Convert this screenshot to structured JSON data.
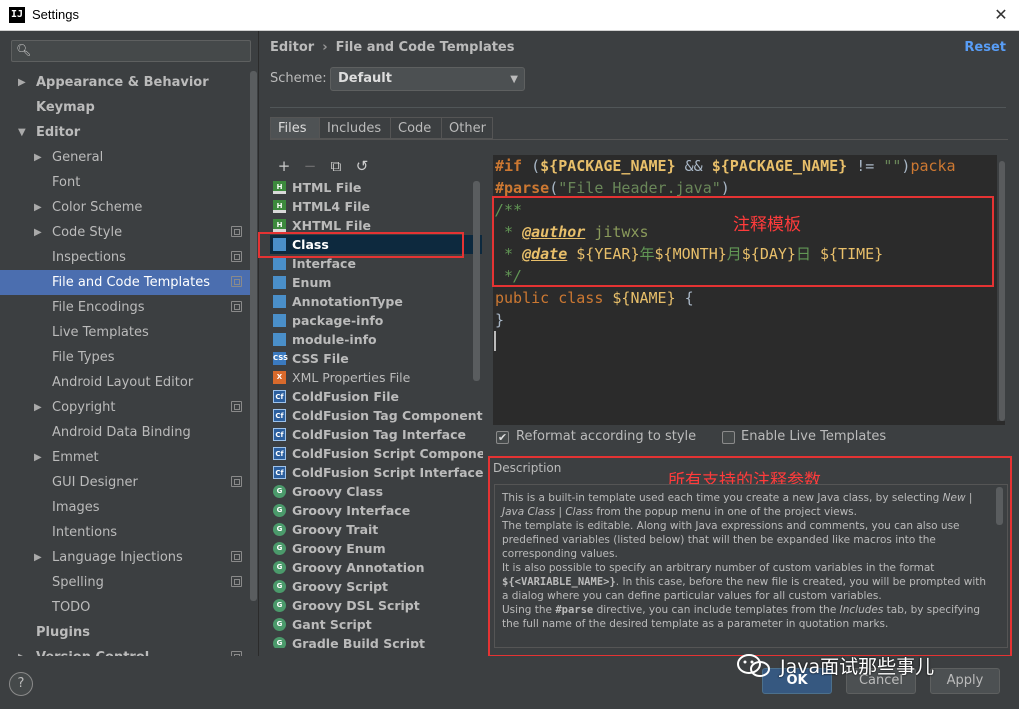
{
  "window": {
    "title": "Settings",
    "app_icon": "IJ"
  },
  "search": {
    "placeholder": ""
  },
  "sidebar": {
    "items": [
      {
        "label": "Appearance & Behavior",
        "level": 0,
        "arrow": "▶",
        "bold": true
      },
      {
        "label": "Keymap",
        "level": 0,
        "arrow": "",
        "bold": true
      },
      {
        "label": "Editor",
        "level": 0,
        "arrow": "▼",
        "bold": true
      },
      {
        "label": "General",
        "level": 1,
        "arrow": "▶"
      },
      {
        "label": "Font",
        "level": 1,
        "arrow": ""
      },
      {
        "label": "Color Scheme",
        "level": 1,
        "arrow": "▶"
      },
      {
        "label": "Code Style",
        "level": 1,
        "arrow": "▶",
        "proj": true
      },
      {
        "label": "Inspections",
        "level": 1,
        "arrow": "",
        "proj": true
      },
      {
        "label": "File and Code Templates",
        "level": 1,
        "arrow": "",
        "proj": true,
        "selected": true
      },
      {
        "label": "File Encodings",
        "level": 1,
        "arrow": "",
        "proj": true
      },
      {
        "label": "Live Templates",
        "level": 1,
        "arrow": ""
      },
      {
        "label": "File Types",
        "level": 1,
        "arrow": ""
      },
      {
        "label": "Android Layout Editor",
        "level": 1,
        "arrow": ""
      },
      {
        "label": "Copyright",
        "level": 1,
        "arrow": "▶",
        "proj": true
      },
      {
        "label": "Android Data Binding",
        "level": 1,
        "arrow": ""
      },
      {
        "label": "Emmet",
        "level": 1,
        "arrow": "▶"
      },
      {
        "label": "GUI Designer",
        "level": 1,
        "arrow": "",
        "proj": true
      },
      {
        "label": "Images",
        "level": 1,
        "arrow": ""
      },
      {
        "label": "Intentions",
        "level": 1,
        "arrow": ""
      },
      {
        "label": "Language Injections",
        "level": 1,
        "arrow": "▶",
        "proj": true
      },
      {
        "label": "Spelling",
        "level": 1,
        "arrow": "",
        "proj": true
      },
      {
        "label": "TODO",
        "level": 1,
        "arrow": ""
      },
      {
        "label": "Plugins",
        "level": 0,
        "arrow": "",
        "bold": true
      },
      {
        "label": "Version Control",
        "level": 0,
        "arrow": "▶",
        "bold": true,
        "proj": true
      }
    ]
  },
  "header": {
    "breadcrumb": [
      "Editor",
      "File and Code Templates"
    ],
    "separator": "›",
    "reset_label": "Reset"
  },
  "scheme": {
    "label": "Scheme:",
    "value": "Default"
  },
  "tabs": [
    "Files",
    "Includes",
    "Code",
    "Other"
  ],
  "active_tab": "Files",
  "toolbar": {
    "add": "+",
    "remove": "−",
    "copy": "⧉",
    "revert": "↺"
  },
  "templates": [
    {
      "name": "HTML File",
      "icon": "html"
    },
    {
      "name": "HTML4 File",
      "icon": "html"
    },
    {
      "name": "XHTML File",
      "icon": "html"
    },
    {
      "name": "Class",
      "icon": "java",
      "selected": true
    },
    {
      "name": "Interface",
      "icon": "java"
    },
    {
      "name": "Enum",
      "icon": "java"
    },
    {
      "name": "AnnotationType",
      "icon": "java"
    },
    {
      "name": "package-info",
      "icon": "java"
    },
    {
      "name": "module-info",
      "icon": "java"
    },
    {
      "name": "CSS File",
      "icon": "css"
    },
    {
      "name": "XML Properties File",
      "icon": "xml",
      "plain": true
    },
    {
      "name": "ColdFusion File",
      "icon": "cf"
    },
    {
      "name": "ColdFusion Tag Component",
      "icon": "cf"
    },
    {
      "name": "ColdFusion Tag Interface",
      "icon": "cf"
    },
    {
      "name": "ColdFusion Script Component",
      "icon": "cf"
    },
    {
      "name": "ColdFusion Script Interface",
      "icon": "cf"
    },
    {
      "name": "Groovy Class",
      "icon": "groovy"
    },
    {
      "name": "Groovy Interface",
      "icon": "groovy"
    },
    {
      "name": "Groovy Trait",
      "icon": "groovy"
    },
    {
      "name": "Groovy Enum",
      "icon": "groovy"
    },
    {
      "name": "Groovy Annotation",
      "icon": "groovy"
    },
    {
      "name": "Groovy Script",
      "icon": "groovy"
    },
    {
      "name": "Groovy DSL Script",
      "icon": "groovy"
    },
    {
      "name": "Gant Script",
      "icon": "groovy"
    },
    {
      "name": "Gradle Build Script",
      "icon": "groovy"
    }
  ],
  "editor": {
    "line1": {
      "kw": "#if",
      "a": " (",
      "v1": "${PACKAGE_NAME}",
      "b": " && ",
      "v2": "${PACKAGE_NAME}",
      "c": " != ",
      "s": "\"\"",
      "d": ")",
      "e": "packa"
    },
    "line2": {
      "kw": "#parse",
      "a": "(",
      "s": "\"File Header.java\"",
      "b": ")"
    },
    "line3": "/**",
    "line4": {
      "star": " * ",
      "tag": "@author",
      "val": " jitwxs"
    },
    "line5": {
      "star": " * ",
      "tag": "@date",
      "sp": " ",
      "v1": "${YEAR}",
      "c1": "年",
      "v2": "${MONTH}",
      "c2": "月",
      "v3": "${DAY}",
      "c3": "日 ",
      "v4": "${TIME}"
    },
    "line6": " */",
    "line7": {
      "kw": "public class",
      "sp": " ",
      "v": "${NAME}",
      "b": " {"
    },
    "line8": "}"
  },
  "annotations": {
    "comment": "注释模板",
    "params": "所有支持的注释参数"
  },
  "options": {
    "reformat": "Reformat according to style",
    "reformat_checked": true,
    "live": "Enable Live Templates",
    "live_checked": false,
    "check_mark": "✔"
  },
  "description": {
    "title": "Description",
    "p1a": "This is a built-in template used each time you create a new Java class, by selecting ",
    "p1b": "New | Java Class | Class",
    "p1c": " from the popup menu in one of the project views.",
    "p2": "The template is editable. Along with Java expressions and comments, you can also use predefined variables (listed below) that will then be expanded like macros into the corresponding values.",
    "p3a": "It is also possible to specify an arbitrary number of custom variables in the format ",
    "p3b": "${<VARIABLE_NAME>}",
    "p3c": ". In this case, before the new file is created, you will be prompted with a dialog where you can define particular values for all custom variables.",
    "p4a": "Using the ",
    "p4b": "#parse",
    "p4c": " directive, you can include templates from the ",
    "p4d": "Includes",
    "p4e": " tab, by specifying the full name of the desired template as a parameter in quotation marks."
  },
  "footer": {
    "help": "?",
    "ok": "OK",
    "cancel": "Cancel",
    "apply": "Apply"
  },
  "watermark": "Java面试那些事儿"
}
